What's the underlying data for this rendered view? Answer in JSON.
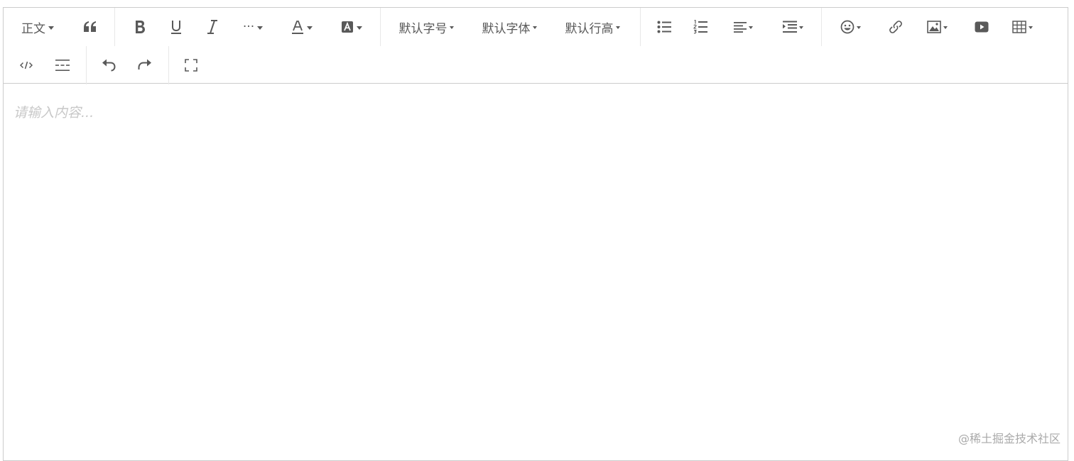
{
  "toolbar": {
    "heading_label": "正文",
    "font_size_label": "默认字号",
    "font_family_label": "默认字体",
    "line_height_label": "默认行高",
    "more_label": "···"
  },
  "editor": {
    "placeholder": "请输入内容..."
  },
  "watermark": "@稀土掘金技术社区",
  "colors": {
    "border": "#cccccc",
    "divider": "#e8e8e8",
    "icon": "#595959",
    "placeholder": "#c8c8c8",
    "watermark": "#aaaaaa"
  },
  "icons": [
    "blockquote-icon",
    "bold-icon",
    "underline-icon",
    "italic-icon",
    "more-icon",
    "font-color-icon",
    "background-color-icon",
    "bulleted-list-icon",
    "numbered-list-icon",
    "justify-icon",
    "indent-icon",
    "emotion-icon",
    "link-icon",
    "image-icon",
    "video-icon",
    "table-icon",
    "code-block-icon",
    "divider-icon",
    "undo-icon",
    "redo-icon",
    "fullscreen-icon"
  ]
}
